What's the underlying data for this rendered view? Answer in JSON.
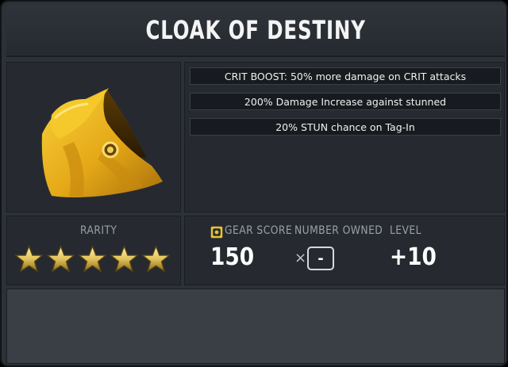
{
  "item": {
    "title": "CLOAK OF DESTINY",
    "icon": "golden-cloak-icon"
  },
  "stats": [
    "CRIT BOOST: 50% more damage on CRIT attacks",
    "200% Damage Increase against stunned",
    "20% STUN chance on Tag-In"
  ],
  "rarity": {
    "label": "RARITY",
    "stars": 5,
    "star_color": "#e3c35a"
  },
  "gear_score": {
    "label": "GEAR SCORE",
    "value": "150",
    "icon": "gear-score-icon",
    "icon_color": "#e8c237"
  },
  "number_owned": {
    "label": "NUMBER OWNED",
    "multiplier": "×",
    "value": "-"
  },
  "level": {
    "label": "LEVEL",
    "value": "+10"
  }
}
